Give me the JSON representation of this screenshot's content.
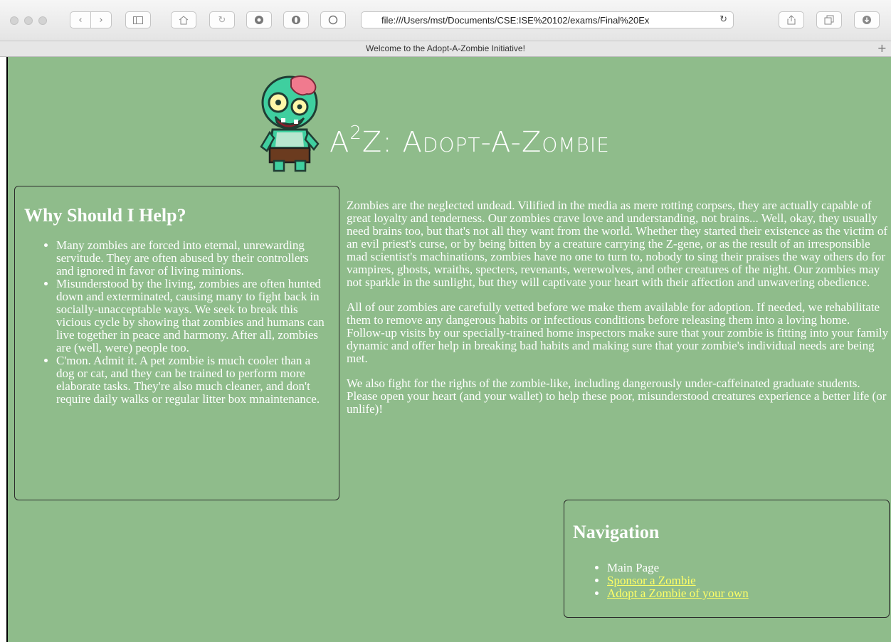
{
  "browser": {
    "url": "file:///Users/mst/Documents/CSE:ISE%20102/exams/Final%20Ex",
    "tab_title": "Welcome to the Adopt-A-Zombie Initiative!",
    "new_tab_glyph": "+",
    "reload_glyph": "↻",
    "toolbar_icons": [
      "back-icon",
      "forward-icon",
      "sidebar-icon",
      "home-icon",
      "reload-icon",
      "extension-icon-1",
      "extension-icon-2",
      "extension-icon-3",
      "share-icon",
      "tabs-icon",
      "downloads-icon"
    ]
  },
  "header": {
    "title_prefix": "A",
    "title_sup": "2",
    "title_rest": "Z: Adopt-A-Zombie",
    "colors": {
      "background": "#8fbc8b",
      "text": "#ffffff",
      "link": "#ffff66"
    }
  },
  "why": {
    "heading": "Why Should I Help?",
    "items": [
      "Many zombies are forced into eternal, unrewarding servitude. They are often abused by their controllers and ignored in favor of living minions.",
      "Misunderstood by the living, zombies are often hunted down and exterminated, causing many to fight back in socially-unacceptable ways. We seek to break this vicious cycle by showing that zombies and humans can live together in peace and harmony. After all, zombies are (well, were) people too.",
      "C'mon. Admit it. A pet zombie is much cooler than a dog or cat, and they can be trained to perform more elaborate tasks. They're also much cleaner, and don't require daily walks or regular litter box mnaintenance."
    ]
  },
  "main": {
    "paragraphs": [
      "Zombies are the neglected undead. Vilified in the media as mere rotting corpses, they are actually capable of great loyalty and tenderness. Our zombies crave love and understanding, not brains... Well, okay, they usually need brains too, but that's not all they want from the world. Whether they started their existence as the victim of an evil priest's curse, or by being bitten by a creature carrying the Z-gene, or as the result of an irresponsible mad scientist's machinations, zombies have no one to turn to, nobody to sing their praises the way others do for vampires, ghosts, wraiths, specters, revenants, werewolves, and other creatures of the night. Our zombies may not sparkle in the sunlight, but they will captivate your heart with their affection and unwavering obedience.",
      "All of our zombies are carefully vetted before we make them available for adoption. If needed, we rehabilitate them to remove any dangerous habits or infectious conditions before releasing them into a loving home. Follow-up visits by our specially-trained home inspectors make sure that your zombie is fitting into your family dynamic and offer help in breaking bad habits and making sure that your zombie's individual needs are being met.",
      "We also fight for the rights of the zombie-like, including dangerously under-caffeinated graduate students. Please open your heart (and your wallet) to help these poor, misunderstood creatures experience a better life (or unlife)!"
    ]
  },
  "nav": {
    "heading": "Navigation",
    "items": [
      {
        "label": "Main Page",
        "link": false
      },
      {
        "label": "Sponsor a Zombie",
        "link": true
      },
      {
        "label": "Adopt a Zombie of your own",
        "link": true
      }
    ]
  }
}
